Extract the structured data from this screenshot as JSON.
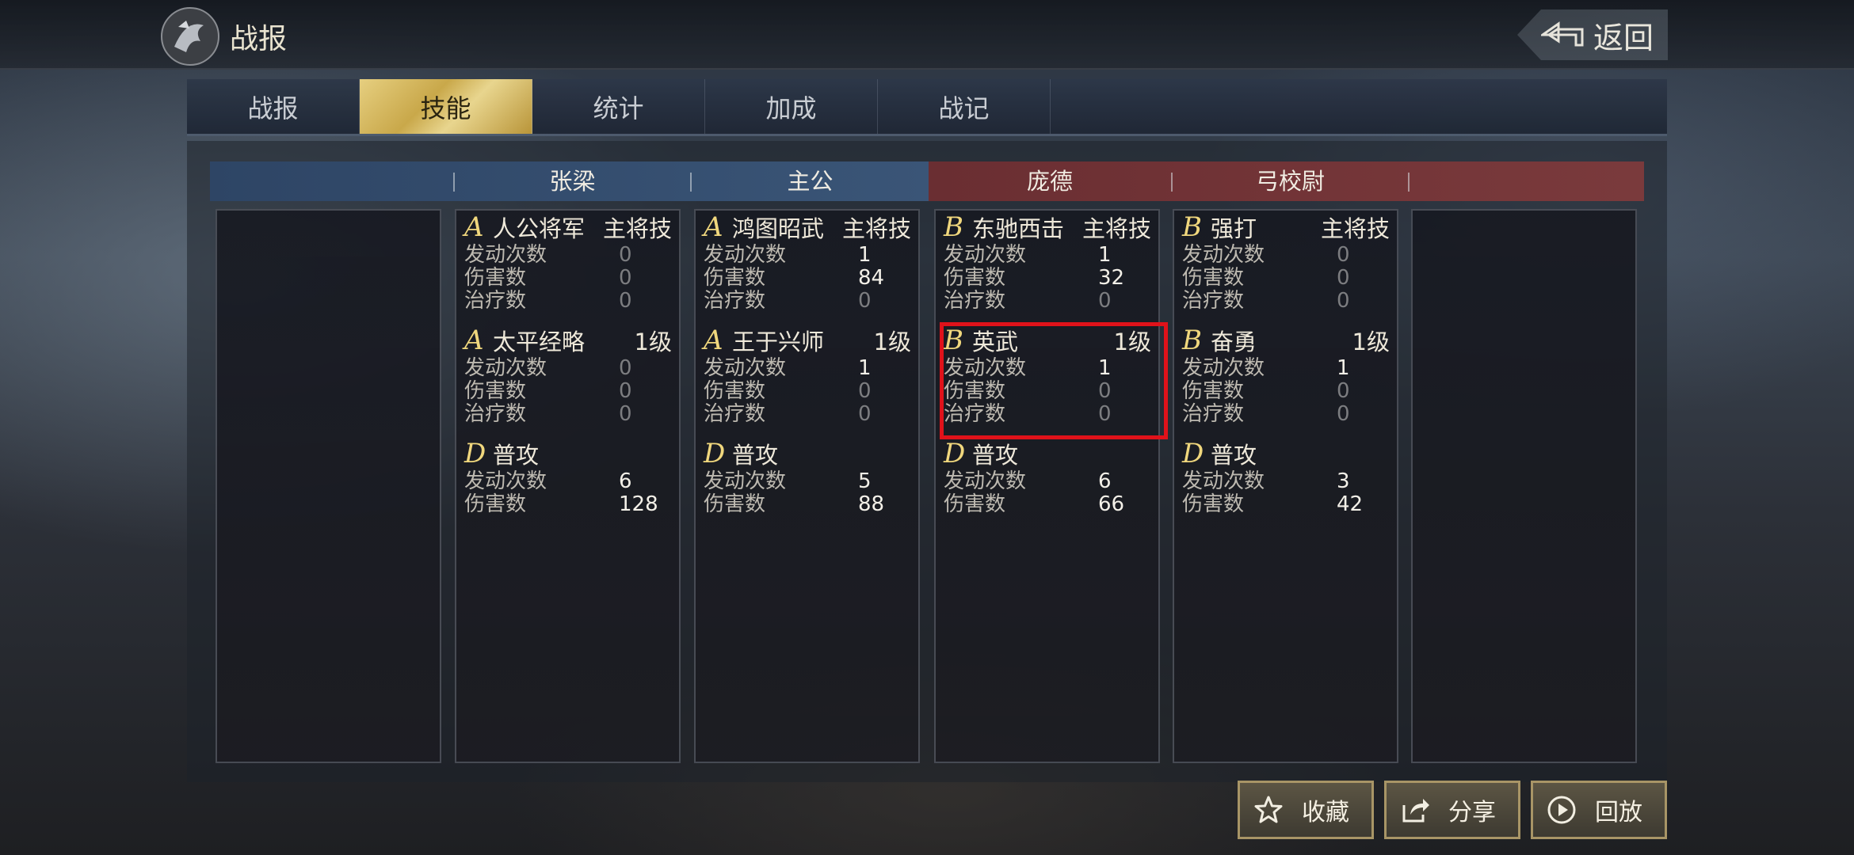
{
  "header": {
    "title": "战报",
    "back_label": "返回"
  },
  "tabs": [
    {
      "label": "战报",
      "active": false
    },
    {
      "label": "技能",
      "active": true
    },
    {
      "label": "统计",
      "active": false
    },
    {
      "label": "加成",
      "active": false
    },
    {
      "label": "战记",
      "active": false
    }
  ],
  "teams": {
    "ally_color": "#3a5577",
    "enemy_color": "#7a3a3c",
    "generals": [
      "张梁",
      "主公",
      "庞德",
      "弓校尉"
    ]
  },
  "columns": [
    {
      "general": "张梁",
      "skills": [
        {
          "grade": "A",
          "name": "人公将军",
          "type": "主将技",
          "stats": [
            {
              "label": "发动次数",
              "value": "0"
            },
            {
              "label": "伤害数",
              "value": "0"
            },
            {
              "label": "治疗数",
              "value": "0"
            }
          ]
        },
        {
          "grade": "A",
          "name": "太平经略",
          "type": "1级",
          "stats": [
            {
              "label": "发动次数",
              "value": "0"
            },
            {
              "label": "伤害数",
              "value": "0"
            },
            {
              "label": "治疗数",
              "value": "0"
            }
          ]
        },
        {
          "grade": "D",
          "name": "普攻",
          "type": "",
          "stats": [
            {
              "label": "发动次数",
              "value": "6"
            },
            {
              "label": "伤害数",
              "value": "128"
            }
          ]
        }
      ]
    },
    {
      "general": "主公",
      "skills": [
        {
          "grade": "A",
          "name": "鸿图昭武",
          "type": "主将技",
          "stats": [
            {
              "label": "发动次数",
              "value": "1"
            },
            {
              "label": "伤害数",
              "value": "84"
            },
            {
              "label": "治疗数",
              "value": "0"
            }
          ]
        },
        {
          "grade": "A",
          "name": "王于兴师",
          "type": "1级",
          "stats": [
            {
              "label": "发动次数",
              "value": "1"
            },
            {
              "label": "伤害数",
              "value": "0"
            },
            {
              "label": "治疗数",
              "value": "0"
            }
          ]
        },
        {
          "grade": "D",
          "name": "普攻",
          "type": "",
          "stats": [
            {
              "label": "发动次数",
              "value": "5"
            },
            {
              "label": "伤害数",
              "value": "88"
            }
          ]
        }
      ]
    },
    {
      "general": "庞德",
      "skills": [
        {
          "grade": "B",
          "name": "东驰西击",
          "type": "主将技",
          "stats": [
            {
              "label": "发动次数",
              "value": "1"
            },
            {
              "label": "伤害数",
              "value": "32"
            },
            {
              "label": "治疗数",
              "value": "0"
            }
          ]
        },
        {
          "grade": "B",
          "name": "英武",
          "type": "1级",
          "stats": [
            {
              "label": "发动次数",
              "value": "1"
            },
            {
              "label": "伤害数",
              "value": "0"
            },
            {
              "label": "治疗数",
              "value": "0"
            }
          ]
        },
        {
          "grade": "D",
          "name": "普攻",
          "type": "",
          "stats": [
            {
              "label": "发动次数",
              "value": "6"
            },
            {
              "label": "伤害数",
              "value": "66"
            }
          ]
        }
      ]
    },
    {
      "general": "弓校尉",
      "skills": [
        {
          "grade": "B",
          "name": "强打",
          "type": "主将技",
          "stats": [
            {
              "label": "发动次数",
              "value": "0"
            },
            {
              "label": "伤害数",
              "value": "0"
            },
            {
              "label": "治疗数",
              "value": "0"
            }
          ]
        },
        {
          "grade": "B",
          "name": "奋勇",
          "type": "1级",
          "stats": [
            {
              "label": "发动次数",
              "value": "1"
            },
            {
              "label": "伤害数",
              "value": "0"
            },
            {
              "label": "治疗数",
              "value": "0"
            }
          ]
        },
        {
          "grade": "D",
          "name": "普攻",
          "type": "",
          "stats": [
            {
              "label": "发动次数",
              "value": "3"
            },
            {
              "label": "伤害数",
              "value": "42"
            }
          ]
        }
      ]
    }
  ],
  "highlight_color": "#e0121a",
  "actions": {
    "favorite": "收藏",
    "share": "分享",
    "replay": "回放"
  },
  "icons": {
    "back": "back-arrow-icon",
    "favorite": "star-icon",
    "share": "share-icon",
    "replay": "play-icon"
  }
}
